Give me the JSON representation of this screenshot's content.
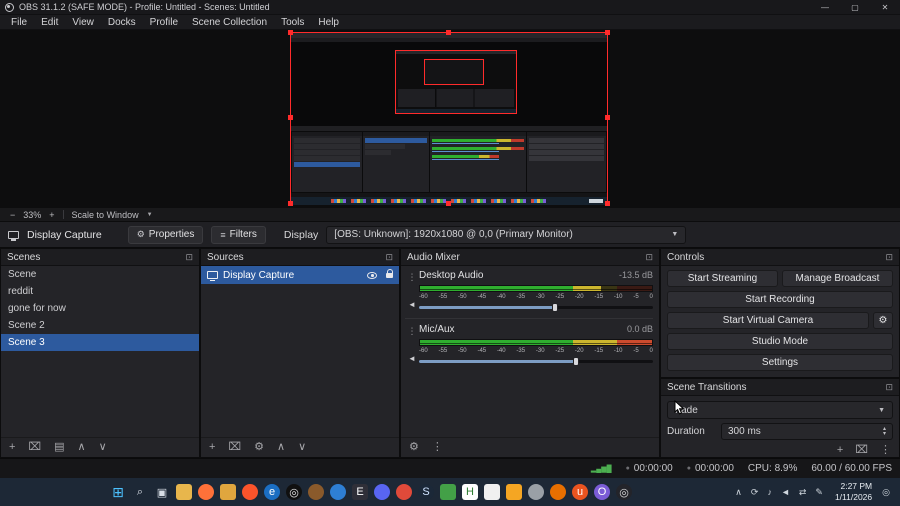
{
  "icons": {
    "gear": "⚙",
    "filters": "≡",
    "caret_down": "▼",
    "minus": "−",
    "plus": "+",
    "dock_popout": "⊡",
    "kebab": "⋮",
    "trash": "⌧",
    "up": "∧",
    "down": "∨",
    "grid": "▤",
    "dot": "●",
    "speaker": "◄",
    "signal_bars": "▂▄▆█",
    "spin_up": "▴",
    "spin_down": "▾",
    "obs_logo": "◎"
  },
  "titlebar": {
    "title": "OBS 31.1.2 (SAFE MODE) - Profile: Untitled - Scenes: Untitled",
    "minimize": "—",
    "maximize": "▢",
    "close": "✕"
  },
  "menubar": {
    "items": [
      "File",
      "Edit",
      "View",
      "Docks",
      "Profile",
      "Scene Collection",
      "Tools",
      "Help"
    ]
  },
  "preview": {
    "zoom": "33%",
    "scale_mode": "Scale to Window"
  },
  "source_toolbar": {
    "source_label": "Display Capture",
    "properties": "Properties",
    "filters": "Filters",
    "display_label": "Display",
    "display_value": "[OBS: Unknown]: 1920x1080 @ 0,0 (Primary Monitor)"
  },
  "scenes": {
    "title": "Scenes",
    "items": [
      {
        "label": "Scene",
        "selected": false
      },
      {
        "label": "reddit",
        "selected": false
      },
      {
        "label": "gone for now",
        "selected": false
      },
      {
        "label": "Scene 2",
        "selected": false
      },
      {
        "label": "Scene 3",
        "selected": true
      }
    ]
  },
  "sources": {
    "title": "Sources",
    "items": [
      {
        "label": "Display Capture",
        "selected": true
      }
    ]
  },
  "mixer": {
    "title": "Audio Mixer",
    "ticks": [
      "-60",
      "-55",
      "-50",
      "-45",
      "-40",
      "-35",
      "-30",
      "-25",
      "-20",
      "-15",
      "-10",
      "-5",
      "0"
    ],
    "channels": [
      {
        "name": "Desktop Audio",
        "db": "-13.5 dB",
        "level_pct": 78,
        "slider_pct": 58
      },
      {
        "name": "Mic/Aux",
        "db": "0.0 dB",
        "level_pct": 100,
        "slider_pct": 67
      }
    ]
  },
  "controls": {
    "title": "Controls",
    "start_streaming": "Start Streaming",
    "manage_broadcast": "Manage Broadcast",
    "start_recording": "Start Recording",
    "start_virtual_camera": "Start Virtual Camera",
    "studio_mode": "Studio Mode",
    "settings": "Settings"
  },
  "scene_transitions": {
    "title": "Scene Transitions",
    "transition_value": "Fade",
    "duration_label": "Duration",
    "duration_value": "300 ms"
  },
  "statusbar": {
    "rec_timer": "00:00:00",
    "stream_timer": "00:00:00",
    "cpu": "CPU: 8.9%",
    "fps": "60.00 / 60.00 FPS"
  },
  "taskbar": {
    "time": "2:27 PM",
    "date": "1/11/2026",
    "icons": [
      {
        "name": "start-button",
        "glyph": "⊞",
        "fg": "#4cc2ff",
        "shape": "square",
        "large": true
      },
      {
        "name": "search-icon",
        "glyph": "⌕",
        "fg": "#d8dee6",
        "shape": "square"
      },
      {
        "name": "task-view-icon",
        "glyph": "▣",
        "fg": "#d8dee6",
        "shape": "square"
      },
      {
        "name": "file-explorer-icon",
        "bg": "#e8b64c",
        "shape": "square"
      },
      {
        "name": "firefox-icon",
        "bg": "#ff7139",
        "shape": "circle"
      },
      {
        "name": "folder-icon",
        "bg": "#e0a63e",
        "shape": "square"
      },
      {
        "name": "brave-icon",
        "bg": "#fb542b",
        "shape": "circle"
      },
      {
        "name": "edge-icon",
        "glyph": "e",
        "bg": "#1b6ec2",
        "fg": "#ffffff",
        "shape": "circle"
      },
      {
        "name": "obs-icon",
        "glyph": "◎",
        "bg": "#101010",
        "fg": "#e8e8e8",
        "shape": "circle"
      },
      {
        "name": "paw-app-icon",
        "bg": "#8a5a2b",
        "shape": "circle"
      },
      {
        "name": "globe-app-icon",
        "bg": "#2e7fd4",
        "shape": "circle"
      },
      {
        "name": "epic-games-icon",
        "glyph": "E",
        "bg": "#2f2f38",
        "fg": "#ffffff",
        "shape": "square"
      },
      {
        "name": "discord-icon",
        "bg": "#5865f2",
        "shape": "circle"
      },
      {
        "name": "flame-app-icon",
        "bg": "#e04a3a",
        "shape": "circle"
      },
      {
        "name": "steam-icon",
        "glyph": "S",
        "bg": "#1b2838",
        "fg": "#cfe3ff",
        "shape": "circle"
      },
      {
        "name": "green-app-icon",
        "bg": "#43a047",
        "shape": "square"
      },
      {
        "name": "h-app-icon",
        "glyph": "H",
        "bg": "#ffffff",
        "fg": "#2e7d32",
        "shape": "square"
      },
      {
        "name": "notes-app-icon",
        "bg": "#f0f0f0",
        "shape": "square"
      },
      {
        "name": "lightning-app-icon",
        "bg": "#f5a623",
        "shape": "square"
      },
      {
        "name": "gray-app-icon",
        "bg": "#9aa0a6",
        "shape": "circle"
      },
      {
        "name": "java-app-icon",
        "bg": "#e76f00",
        "shape": "circle"
      },
      {
        "name": "ubuntu-icon",
        "glyph": "u",
        "bg": "#e95420",
        "fg": "#ffffff",
        "shape": "circle"
      },
      {
        "name": "purple-app-icon",
        "glyph": "O",
        "bg": "#7b5cd6",
        "fg": "#ffffff",
        "shape": "circle"
      },
      {
        "name": "obs-tray-icon",
        "glyph": "◎",
        "bg": "#23242a",
        "fg": "#dddddd",
        "shape": "circle"
      }
    ],
    "tray": [
      {
        "name": "tray-chevron-icon",
        "glyph": "∧"
      },
      {
        "name": "sync-tray-icon",
        "glyph": "⟳"
      },
      {
        "name": "media-tray-icon",
        "glyph": "♪"
      },
      {
        "name": "volume-tray-icon",
        "glyph": "◄"
      },
      {
        "name": "network-tray-icon",
        "glyph": "⇄"
      },
      {
        "name": "pen-tray-icon",
        "glyph": "✎"
      }
    ],
    "bell": "◎"
  }
}
